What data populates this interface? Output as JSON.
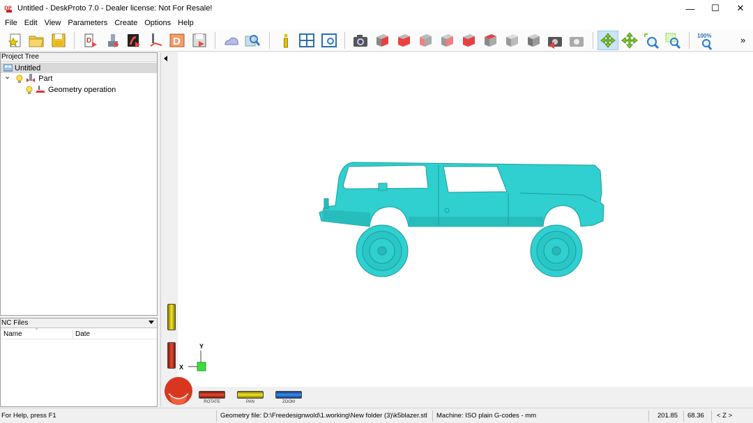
{
  "window": {
    "app_icon_text": "DP",
    "title": "Untitled - DeskProto 7.0 - Dealer license: Not For Resale!",
    "minimize_glyph": "—",
    "maximize_glyph": "☐",
    "close_glyph": "✕"
  },
  "menu": [
    "File",
    "Edit",
    "View",
    "Parameters",
    "Create",
    "Options",
    "Help"
  ],
  "toolbar": {
    "zoom_100_label": "100%",
    "overflow_glyph": "»",
    "icons": [
      "new-project-icon",
      "open-folder-icon",
      "save-icon",
      "part-icon",
      "import-part-icon",
      "export-icon",
      "toolpath-icon",
      "d-icon",
      "save-as-icon",
      "cloud-icon",
      "preview-icon",
      "info-icon",
      "layout-icon",
      "window-icon",
      "camera-icon",
      "view-front-cube-icon",
      "view-right-cube-icon",
      "view-left-cube-icon",
      "view-back-cube-icon",
      "view-bottom-cube-icon",
      "view-top-cube-icon",
      "view-iso-cube-icon",
      "view-gray-cube-icon",
      "camera-reset-icon",
      "camera-gray-icon",
      "rotate-icon",
      "pan-icon",
      "zoom-in-icon",
      "zoom-window-icon",
      "zoom-100-icon"
    ],
    "active_tool": "rotate-icon"
  },
  "project_tree": {
    "header": "Project Tree",
    "root": "Untitled",
    "expander_glyph": "⌄",
    "part": "Part",
    "operation": "Geometry operation"
  },
  "nc_files": {
    "header": "NC Files",
    "columns": [
      "Name",
      "Date"
    ],
    "rows": []
  },
  "viewport": {
    "axis_y_label": "Y",
    "axis_x_label": "X",
    "model_color": "#2fd0cf",
    "sliders": {
      "rotate_label": "ROTATE",
      "pan_label": "PAN",
      "zoom_label": "ZOOM"
    }
  },
  "status": {
    "help": "For Help, press F1",
    "geometry_file": "Geometry file: D:\\Freedesignwold\\1.working\\New folder (3)\\k5blazer.stl",
    "machine": "Machine: ISO plain G-codes - mm",
    "x": "201.85",
    "y": "68.36",
    "axis": "< Z >"
  }
}
